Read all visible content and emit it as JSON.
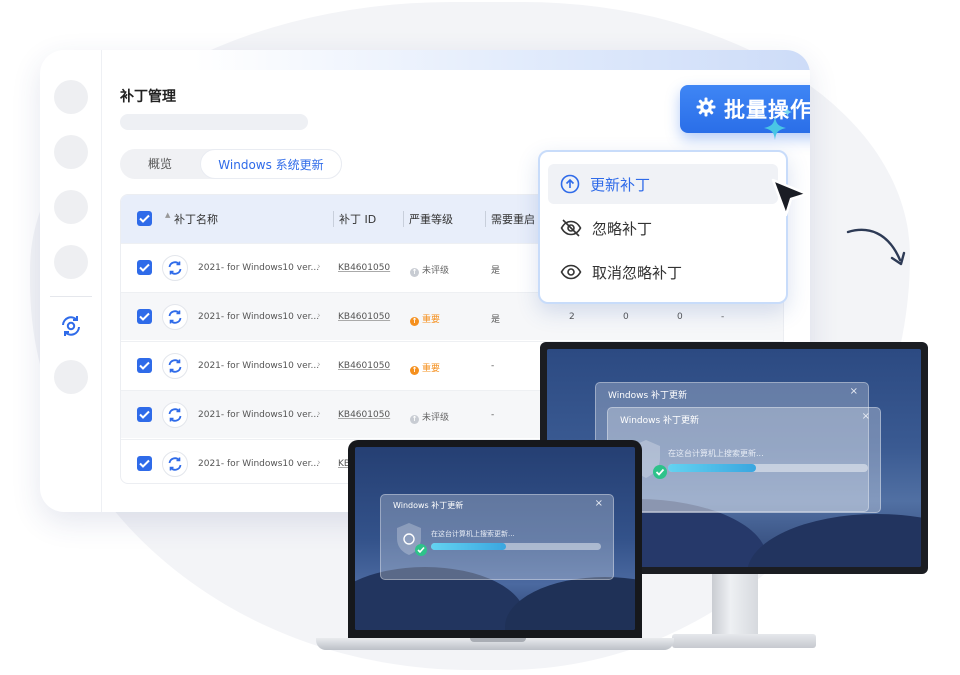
{
  "app": {
    "title": "补丁管理",
    "tabs": [
      {
        "label": "概览",
        "active": false
      },
      {
        "label": "Windows 系统更新",
        "active": true
      }
    ],
    "batch_button": {
      "label": "批量操作"
    },
    "dropdown": [
      {
        "label": "更新补丁",
        "icon": "arrow-up-circle-icon",
        "active": true
      },
      {
        "label": "忽略补丁",
        "icon": "eye-off-icon",
        "active": false
      },
      {
        "label": "取消忽略补丁",
        "icon": "eye-icon",
        "active": false
      }
    ],
    "table": {
      "headers": {
        "name": "补丁名称",
        "id": "补丁 ID",
        "severity": "严重等级",
        "restart": "需要重启"
      },
      "rows": [
        {
          "name": "2021- for Windows10 ver...",
          "id": "KB4601050",
          "severity": "未评级",
          "sev_color": "#c8ccd3",
          "restart": "是",
          "c1": "",
          "c2": "",
          "c3": "",
          "c4": ""
        },
        {
          "name": "2021- for Windows10 ver...",
          "id": "KB4601050",
          "severity": "重要",
          "sev_color": "#f5901e",
          "restart": "是",
          "c1": "2",
          "c2": "0",
          "c3": "0",
          "c4": "-"
        },
        {
          "name": "2021- for Windows10 ver...",
          "id": "KB4601050",
          "severity": "重要",
          "sev_color": "#f5901e",
          "restart": "-",
          "c1": "",
          "c2": "",
          "c3": "",
          "c4": ""
        },
        {
          "name": "2021- for Windows10 ver...",
          "id": "KB4601050",
          "severity": "未评级",
          "sev_color": "#c8ccd3",
          "restart": "-",
          "c1": "",
          "c2": "",
          "c3": "",
          "c4": ""
        },
        {
          "name": "2021- for Windows10 ver...",
          "id": "KB",
          "severity": "",
          "sev_color": "",
          "restart": "",
          "c1": "",
          "c2": "",
          "c3": "",
          "c4": ""
        }
      ]
    }
  },
  "monitor": {
    "back_window_title": "Windows 补丁更新",
    "front_window_title": "Windows 补丁更新",
    "status": "在这台计算机上搜索更新...",
    "progress": 0.44
  },
  "laptop": {
    "window_title": "Windows 补丁更新",
    "status": "在这台计算机上搜索更新...",
    "progress": 0.44
  },
  "colors": {
    "accent": "#2f6be9",
    "important": "#f5901e",
    "unrated": "#c8ccd3",
    "ok": "#2ec28a"
  }
}
